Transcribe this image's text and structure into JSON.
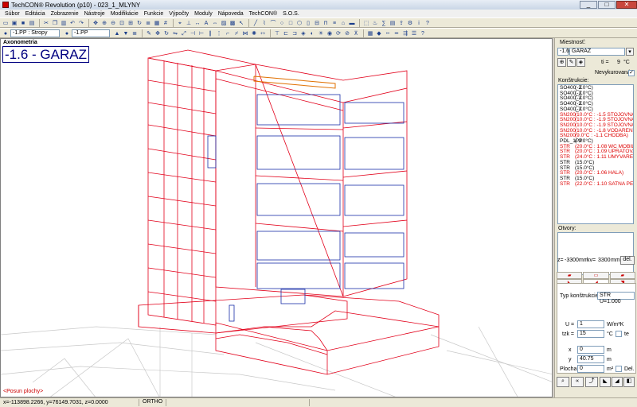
{
  "window": {
    "title": "TechCON® Revolution  (p10) - 023_1_MLYNY",
    "min": "_",
    "max": "□",
    "close": "✕"
  },
  "menu": [
    "Súbor",
    "Editácia",
    "Zobrazenie",
    "Nástroje",
    "Modifikácie",
    "Funkcie",
    "Výpočty",
    "Moduly",
    "Nápoveda",
    "TechCON®",
    "S.O.S."
  ],
  "toolbar2": {
    "layer_combo": "-1.PP : Stropy",
    "floor_combo": "-1.PP"
  },
  "viewport": {
    "mode_label": "Axonometria",
    "floor_title": "-1.6 - GARAZ",
    "hint": "<Posun plochy>"
  },
  "panel": {
    "room_label": "Miestnosť:",
    "room_code": "-1.6",
    "room_name": "GARAZ",
    "temp_label": "ti =",
    "temp_value": "9",
    "temp_unit": "°C",
    "unheated_label": "Nevykurovaná",
    "constructions_label": "Konštrukcie:",
    "constructions": [
      {
        "type": "SO400_Z",
        "desc": "(-3.0°C)",
        "red": false
      },
      {
        "type": "SO400_Z",
        "desc": "(-3.0°C)",
        "red": false
      },
      {
        "type": "SO400_Z",
        "desc": "(-3.0°C)",
        "red": false
      },
      {
        "type": "SO400_Z",
        "desc": "(-3.0°C)",
        "red": false
      },
      {
        "type": "SO400_Z",
        "desc": "(-3.0°C)",
        "red": false
      },
      {
        "type": "SN200",
        "desc": "(10.0°C : -1.5 STOJOVNA)",
        "red": true
      },
      {
        "type": "SN200",
        "desc": "(10.0°C : -1.9 STOJOVNA)",
        "red": true
      },
      {
        "type": "SN200",
        "desc": "(10.0°C : -1.9 STOJOVNA)",
        "red": true
      },
      {
        "type": "SN200",
        "desc": "(10.0°C : -1.8 VODAREN)",
        "red": true
      },
      {
        "type": "SN200",
        "desc": "(9.0°C : -1.1 CHODBA)",
        "red": true
      },
      {
        "type": "PDL_1PP",
        "desc": "(-3.0°C)",
        "red": false
      },
      {
        "type": "STR",
        "desc": "(20.0°C : 1.08 WC MOBILNY)",
        "red": true
      },
      {
        "type": "STR",
        "desc": "(20.0°C : 1.09 UPRATOVACKA)",
        "red": true
      },
      {
        "type": "STR",
        "desc": "(24.0°C : 1.11 UMYVAREN)",
        "red": true
      },
      {
        "type": "STR",
        "desc": "(15.0°C)",
        "red": false
      },
      {
        "type": "STR",
        "desc": "(15.0°C)",
        "red": false
      },
      {
        "type": "STR",
        "desc": "(20.0°C : 1.06 HALA)",
        "red": true
      },
      {
        "type": "STR",
        "desc": "(15.0°C)",
        "red": false
      },
      {
        "type": "STR",
        "desc": "(22.0°C : 1.10 SATNA PERS.)",
        "red": true
      }
    ],
    "openings_label": "Otvory:",
    "z_label": "z=",
    "z_value": "-3300",
    "z_unit": "mm",
    "kv_label": "kv=",
    "kv_value": "3300",
    "kv_unit": "mm",
    "del_label": "del.",
    "type_label": "Typ konštrukcie:",
    "type_value": "STR U=1.000",
    "u_label": "U =",
    "u_value": "1",
    "u_unit": "W/m²K",
    "tzk_label": "tzk =",
    "tzk_value": "15",
    "tzk_unit": "°C",
    "te_label": "te",
    "x_label": "x",
    "x_value": "0",
    "x_unit": "m",
    "y_label": "y",
    "y_value": "40.75",
    "y_unit": "m",
    "area_label": "Plocha",
    "area_value": "0",
    "area_unit": "m²",
    "area_del_label": "Del."
  },
  "status": {
    "coords": "x=-113898.2266, y=76149.7031, z=0.0000",
    "mode": "ORTHO"
  }
}
